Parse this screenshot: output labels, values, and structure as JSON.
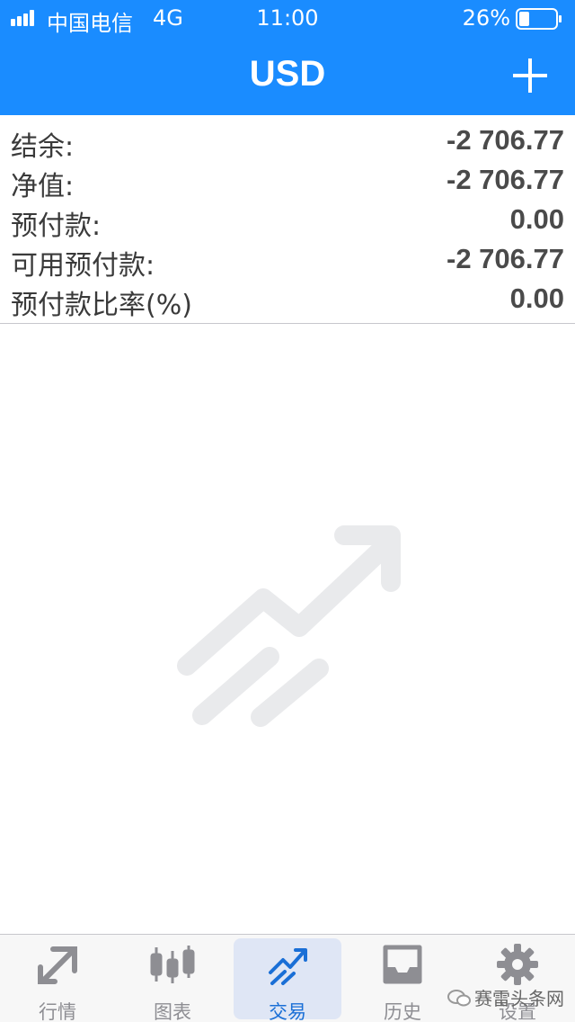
{
  "status_bar": {
    "carrier": "中国电信",
    "network": "4G",
    "time": "11:00",
    "battery_percent": "26%"
  },
  "nav": {
    "title": "USD",
    "add_icon": "plus-icon"
  },
  "summary": [
    {
      "label": "结余:",
      "value": "-2 706.77"
    },
    {
      "label": "净值:",
      "value": "-2 706.77"
    },
    {
      "label": "预付款:",
      "value": "0.00"
    },
    {
      "label": "可用预付款:",
      "value": "-2 706.77"
    },
    {
      "label": "预付款比率(%)",
      "value": "0.00"
    }
  ],
  "empty_state": {
    "icon": "trade-arrow-illustration-icon"
  },
  "tabs": [
    {
      "label": "行情",
      "icon": "quotes-arrows-icon",
      "active": false
    },
    {
      "label": "图表",
      "icon": "candlestick-icon",
      "active": false
    },
    {
      "label": "交易",
      "icon": "trade-trend-icon",
      "active": true
    },
    {
      "label": "历史",
      "icon": "inbox-tray-icon",
      "active": false
    },
    {
      "label": "设置",
      "icon": "gear-icon",
      "active": false
    }
  ],
  "watermark": {
    "text": "赛雷头条网"
  },
  "colors": {
    "brand": "#1a8cff",
    "active_tab": "#1a6fd6",
    "inactive_tab": "#8e8e93"
  }
}
